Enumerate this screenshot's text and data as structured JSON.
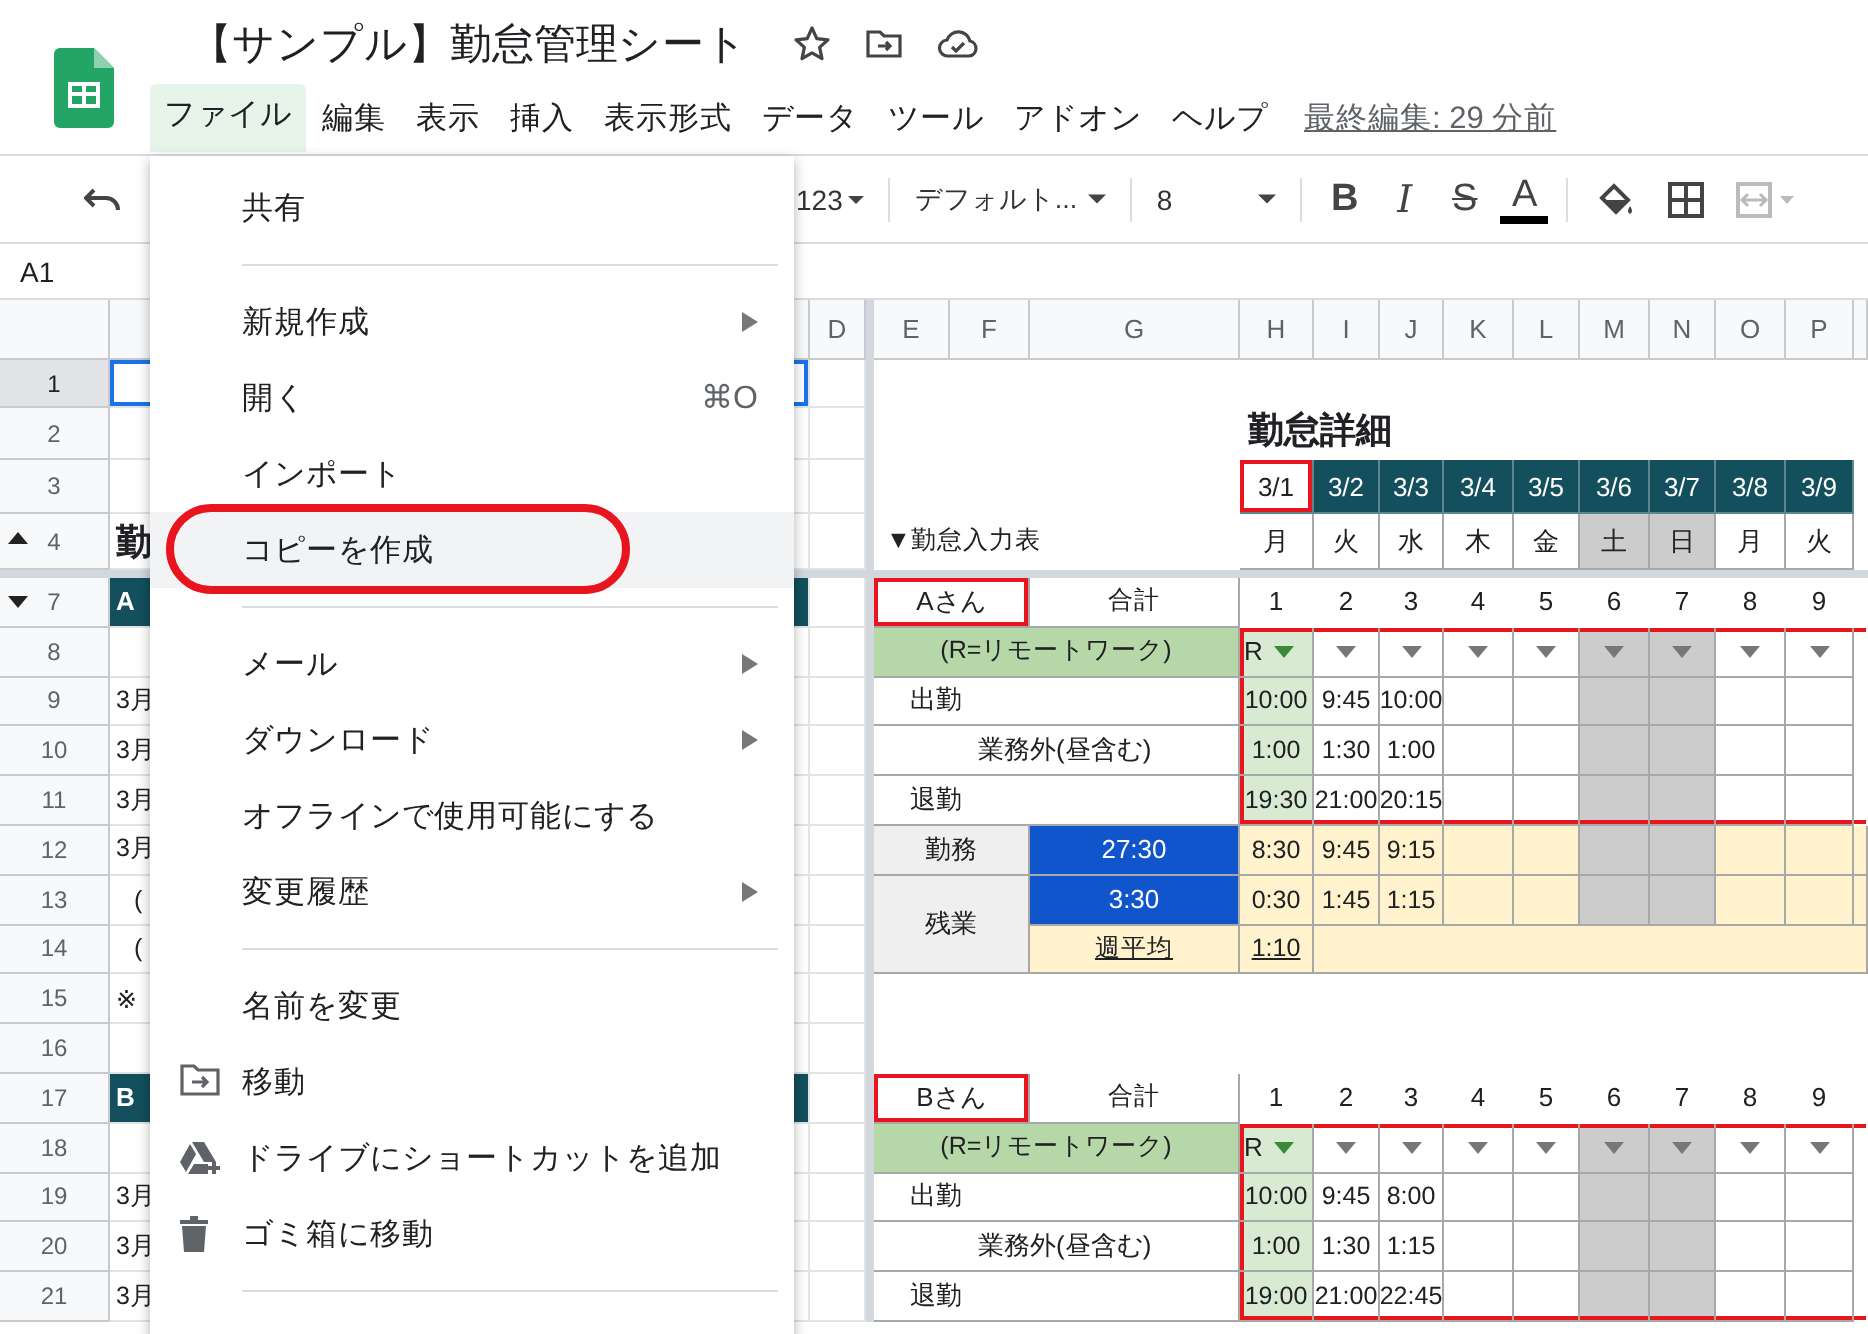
{
  "app": {
    "title": "【サンプル】勤怠管理シート"
  },
  "menubar": [
    {
      "label": "ファイル",
      "selected": true
    },
    {
      "label": "編集",
      "selected": false
    },
    {
      "label": "表示",
      "selected": false
    },
    {
      "label": "挿入",
      "selected": false
    },
    {
      "label": "表示形式",
      "selected": false
    },
    {
      "label": "データ",
      "selected": false
    },
    {
      "label": "ツール",
      "selected": false
    },
    {
      "label": "アドオン",
      "selected": false
    },
    {
      "label": "ヘルプ",
      "selected": false
    }
  ],
  "last_edit": "最終編集: 29 分前",
  "toolbar": {
    "number_format": "123",
    "font": "デフォルト...",
    "font_size": "8",
    "format_buttons": [
      {
        "label": "B",
        "kind": "bold"
      },
      {
        "label": "I",
        "kind": "italic"
      },
      {
        "label": "S",
        "kind": "strike"
      },
      {
        "label": "A",
        "kind": "color"
      }
    ]
  },
  "name_box": "A1",
  "columns": [
    "D",
    "E",
    "F",
    "G",
    "H",
    "I",
    "J",
    "K",
    "L",
    "M",
    "N",
    "O",
    "P"
  ],
  "rows": [
    {
      "number": "1",
      "selected": true,
      "kind": "plain"
    },
    {
      "number": "2",
      "selected": false,
      "kind": "plain"
    },
    {
      "number": "3",
      "selected": false,
      "kind": "plain"
    },
    {
      "number": "4",
      "selected": false,
      "kind": "collapse",
      "left": {
        "text": "勤",
        "kind": "heading"
      }
    },
    {
      "number": "7",
      "selected": false,
      "kind": "expand",
      "left": {
        "text": "A",
        "kind": "name"
      }
    },
    {
      "number": "8",
      "selected": false,
      "kind": "plain"
    },
    {
      "number": "9",
      "selected": false,
      "kind": "plain",
      "left": {
        "text": "3月",
        "kind": "plain"
      }
    },
    {
      "number": "10",
      "selected": false,
      "kind": "plain",
      "left": {
        "text": "3月",
        "kind": "plain"
      }
    },
    {
      "number": "11",
      "selected": false,
      "kind": "plain",
      "left": {
        "text": "3月",
        "kind": "plain"
      }
    },
    {
      "number": "12",
      "selected": false,
      "kind": "plain",
      "left": {
        "text": "3月",
        "kind": "plain"
      }
    },
    {
      "number": "13",
      "selected": false,
      "kind": "plain",
      "left": {
        "text": "(",
        "kind": "indent"
      }
    },
    {
      "number": "14",
      "selected": false,
      "kind": "plain",
      "left": {
        "text": "(",
        "kind": "indent"
      }
    },
    {
      "number": "15",
      "selected": false,
      "kind": "plain",
      "left": {
        "text": "※",
        "kind": "plain"
      }
    },
    {
      "number": "16",
      "selected": false,
      "kind": "plain"
    },
    {
      "number": "17",
      "selected": false,
      "kind": "plain",
      "left": {
        "text": "B",
        "kind": "name"
      }
    },
    {
      "number": "18",
      "selected": false,
      "kind": "plain"
    },
    {
      "number": "19",
      "selected": false,
      "kind": "plain",
      "left": {
        "text": "3月",
        "kind": "plain"
      }
    },
    {
      "number": "20",
      "selected": false,
      "kind": "plain",
      "left": {
        "text": "3月",
        "kind": "plain"
      }
    },
    {
      "number": "21",
      "selected": false,
      "kind": "plain",
      "left": {
        "text": "3月",
        "kind": "plain"
      }
    }
  ],
  "detail": {
    "title": "勤怠詳細",
    "input_label": "▼勤怠入力表",
    "dates": [
      {
        "date": "3/1",
        "weekday": "月",
        "selected": true,
        "weekend": false
      },
      {
        "date": "3/2",
        "weekday": "火",
        "selected": false,
        "weekend": false
      },
      {
        "date": "3/3",
        "weekday": "水",
        "selected": false,
        "weekend": false
      },
      {
        "date": "3/4",
        "weekday": "木",
        "selected": false,
        "weekend": false
      },
      {
        "date": "3/5",
        "weekday": "金",
        "selected": false,
        "weekend": false
      },
      {
        "date": "3/6",
        "weekday": "土",
        "selected": false,
        "weekend": true
      },
      {
        "date": "3/7",
        "weekday": "日",
        "selected": false,
        "weekend": true
      },
      {
        "date": "3/8",
        "weekday": "月",
        "selected": false,
        "weekend": false
      },
      {
        "date": "3/9",
        "weekday": "火",
        "selected": false,
        "weekend": false
      }
    ]
  },
  "employees": [
    {
      "name": "Aさん",
      "name_outlined": true,
      "total_label": "合計",
      "days": [
        "1",
        "2",
        "3",
        "4",
        "5",
        "6",
        "7",
        "8",
        "9"
      ],
      "remote_label": "(R=リモートワーク)",
      "remote": [
        "R"
      ],
      "entries_outlined": true,
      "times": [
        {
          "label": "出勤",
          "kind": "main",
          "values": [
            "10:00",
            "9:45",
            "10:00"
          ]
        },
        {
          "label": "業務外(昼含む)",
          "kind": "sub",
          "values": [
            "1:00",
            "1:30",
            "1:00"
          ]
        },
        {
          "label": "退勤",
          "kind": "main",
          "values": [
            "19:30",
            "21:00",
            "20:15"
          ]
        }
      ],
      "work": {
        "label": "勤務",
        "total": "27:30",
        "values": [
          "8:30",
          "9:45",
          "9:15"
        ]
      },
      "overtime": {
        "label": "残業",
        "total": "3:30",
        "values": [
          "0:30",
          "1:45",
          "1:15"
        ],
        "average_label": "週平均",
        "average": "1:10"
      }
    },
    {
      "name": "Bさん",
      "name_outlined": true,
      "total_label": "合計",
      "days": [
        "1",
        "2",
        "3",
        "4",
        "5",
        "6",
        "7",
        "8",
        "9"
      ],
      "remote_label": "(R=リモートワーク)",
      "remote": [
        "R"
      ],
      "entries_outlined": true,
      "times": [
        {
          "label": "出勤",
          "kind": "main",
          "values": [
            "10:00",
            "9:45",
            "8:00"
          ]
        },
        {
          "label": "業務外(昼含む)",
          "kind": "sub",
          "values": [
            "1:00",
            "1:30",
            "1:15"
          ]
        },
        {
          "label": "退勤",
          "kind": "main",
          "values": [
            "19:00",
            "21:00",
            "22:45"
          ]
        }
      ]
    }
  ],
  "file_menu": [
    {
      "kind": "item",
      "label": "共有",
      "selected": false
    },
    {
      "kind": "divider"
    },
    {
      "kind": "submenu",
      "label": "新規作成",
      "selected": false
    },
    {
      "kind": "item",
      "label": "開く",
      "shortcut": "⌘O",
      "selected": false
    },
    {
      "kind": "item",
      "label": "インポート",
      "selected": false
    },
    {
      "kind": "item",
      "label": "コピーを作成",
      "selected": true,
      "circled": true
    },
    {
      "kind": "divider"
    },
    {
      "kind": "submenu",
      "label": "メール",
      "selected": false
    },
    {
      "kind": "submenu",
      "label": "ダウンロード",
      "selected": false
    },
    {
      "kind": "item",
      "label": "オフラインで使用可能にする",
      "selected": false
    },
    {
      "kind": "submenu",
      "label": "変更履歴",
      "selected": false
    },
    {
      "kind": "divider"
    },
    {
      "kind": "item",
      "label": "名前を変更",
      "selected": false
    },
    {
      "kind": "folder",
      "label": "移動",
      "selected": false
    },
    {
      "kind": "drive",
      "label": "ドライブにショートカットを追加",
      "selected": false
    },
    {
      "kind": "trash",
      "label": "ゴミ箱に移動",
      "selected": false
    },
    {
      "kind": "divider"
    }
  ]
}
